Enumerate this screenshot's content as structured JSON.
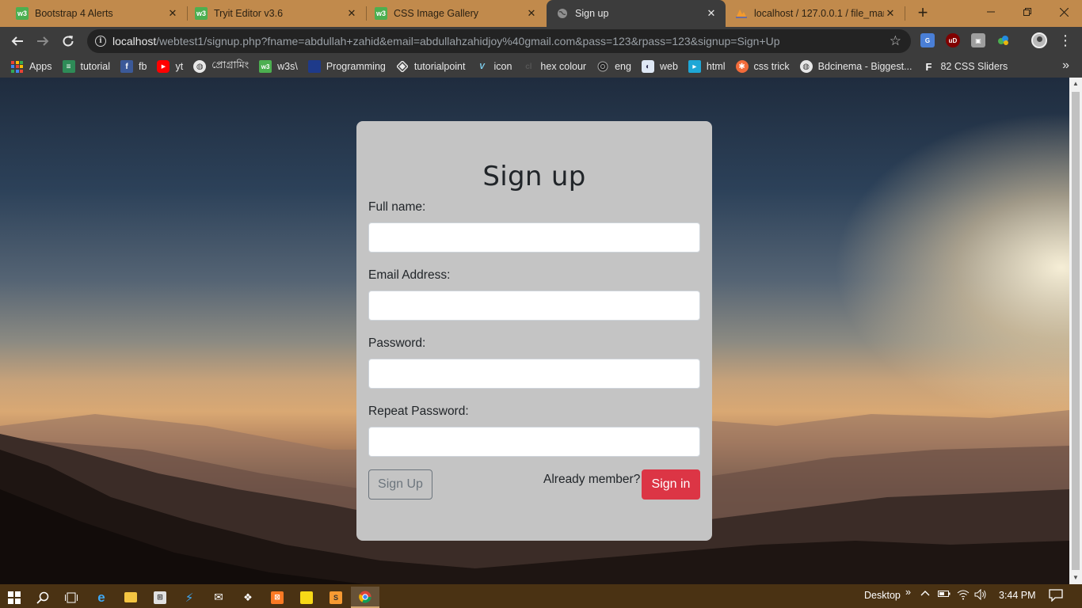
{
  "browser": {
    "tabs": [
      {
        "title": "Bootstrap 4 Alerts",
        "icon": "w3schools-icon",
        "active": false
      },
      {
        "title": "Tryit Editor v3.6",
        "icon": "w3schools-icon",
        "active": false
      },
      {
        "title": "CSS Image Gallery",
        "icon": "w3schools-icon",
        "active": false
      },
      {
        "title": "Sign up",
        "icon": "globe-icon",
        "active": true
      },
      {
        "title": "localhost / 127.0.0.1 / file_man",
        "icon": "phpmyadmin-icon",
        "active": false
      }
    ],
    "new_tab_label": "+",
    "url_host": "localhost",
    "url_rest": "/webtest1/signup.php?fname=abdullah+zahid&email=abdullahzahidjoy%40gmail.com&pass=123&rpass=123&signup=Sign+Up",
    "bookmarks": [
      {
        "label": "Apps",
        "icon": "apps-grid-icon"
      },
      {
        "label": "tutorial",
        "icon": "tutorial-icon"
      },
      {
        "label": "fb",
        "icon": "facebook-icon"
      },
      {
        "label": "yt",
        "icon": "youtube-icon"
      },
      {
        "label": "প্রোগ্রামিং",
        "icon": "globe-icon"
      },
      {
        "label": "w3s\\",
        "icon": "w3schools-icon"
      },
      {
        "label": "Programming",
        "icon": "code-icon"
      },
      {
        "label": "tutorialpoint",
        "icon": "tutorialspoint-icon"
      },
      {
        "label": "icon",
        "icon": "vuetify-icon"
      },
      {
        "label": "hex colour",
        "icon": "hex-icon"
      },
      {
        "label": "eng",
        "icon": "circle-icon"
      },
      {
        "label": "web",
        "icon": "web-icon"
      },
      {
        "label": "html",
        "icon": "html-icon"
      },
      {
        "label": "css trick",
        "icon": "css-tricks-icon"
      },
      {
        "label": "Bdcinema - Biggest...",
        "icon": "globe-icon"
      },
      {
        "label": "82 CSS Sliders",
        "icon": "f-icon"
      }
    ],
    "bookmarks_more": "»"
  },
  "form": {
    "title": "Sign up",
    "full_name_label": "Full name:",
    "email_label": "Email Address:",
    "password_label": "Password:",
    "repeat_password_label": "Repeat Password:",
    "full_name_value": "",
    "email_value": "",
    "password_value": "",
    "repeat_password_value": "",
    "signup_button": "Sign Up",
    "already_member": "Already member?",
    "signin_button": "Sign in"
  },
  "colors": {
    "tabstrip": "#c18a4c",
    "toolbar": "#3c3c3c",
    "card": "#c4c4c4",
    "danger": "#dc3545",
    "secondary": "#6c757d",
    "taskbar": "#4a3213"
  },
  "taskbar": {
    "desktop_label": "Desktop",
    "more_label": "»",
    "time": "3:44 PM"
  }
}
